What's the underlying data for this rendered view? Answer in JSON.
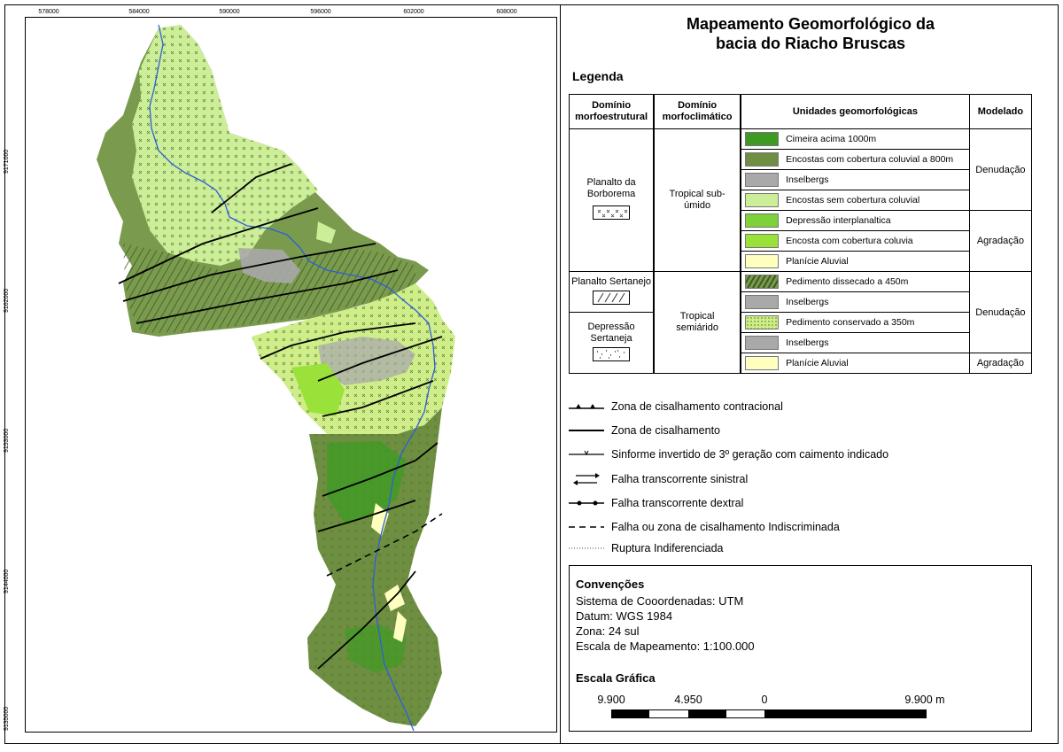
{
  "title_line1": "Mapeamento Geomorfológico da",
  "title_line2": "bacia do Riacho Bruscas",
  "legend_heading": "Legenda",
  "table_headers": {
    "morfoestrutural": "Domínio morfoestrutural",
    "morfoclimatico": "Domínio morfoclimático",
    "unidades": "Unidades geomorfológicas",
    "modelado": "Modelado"
  },
  "domains": {
    "planalto_borborema": "Planalto da Borborema",
    "planalto_sertanejo": "Planalto Sertanejo",
    "depressao_sertaneja": "Depressão Sertaneja",
    "tropical_subumido": "Tropical sub-úmido",
    "tropical_semiarido": "Tropical semiárido"
  },
  "units": [
    {
      "label": "Cimeira acima 1000m",
      "color": "#3f9a24",
      "pattern": "x"
    },
    {
      "label": "Encostas com cobertura coluvial a 800m",
      "color": "#6e8f42",
      "pattern": "x"
    },
    {
      "label": "Inselbergs",
      "color": "#a9a9a9",
      "pattern": "none"
    },
    {
      "label": "Encostas sem cobertura coluvial",
      "color": "#ccee99",
      "pattern": "x"
    },
    {
      "label": "Depressão interplanaltica",
      "color": "#7fd13a",
      "pattern": "x"
    },
    {
      "label": "Encosta com cobertura coluvia",
      "color": "#9ae23a",
      "pattern": "none"
    },
    {
      "label": "Planície Aluvial",
      "color": "#ffffc0",
      "pattern": "none"
    },
    {
      "label": "Pedimento dissecado a 450m",
      "color": "#7a9a4e",
      "pattern": "hatch"
    },
    {
      "label": "Inselbergs",
      "color": "#a9a9a9",
      "pattern": "none"
    },
    {
      "label": "Pedimento conservado a 350m",
      "color": "#cfee8a",
      "pattern": "dot"
    },
    {
      "label": "Inselbergs",
      "color": "#a9a9a9",
      "pattern": "none"
    },
    {
      "label": "Planície Aluvial",
      "color": "#ffffc0",
      "pattern": "none"
    }
  ],
  "modelado": {
    "denudacao": "Denudação",
    "agradacao": "Agradação"
  },
  "line_symbols": [
    {
      "label": "Zona de cisalhamento contracional",
      "icon": "thrust-line-icon"
    },
    {
      "label": "Zona de cisalhamento",
      "icon": "shear-line-icon"
    },
    {
      "label": "Sinforme invertido de 3º geração com caimento indicado",
      "icon": "synform-icon"
    },
    {
      "label": "Falha transcorrente sinistral",
      "icon": "sinistral-fault-icon"
    },
    {
      "label": "Falha transcorrente dextral",
      "icon": "dextral-fault-icon"
    },
    {
      "label": "Falha ou zona de cisalhamento Indiscriminada",
      "icon": "dashed-fault-icon"
    },
    {
      "label": "Ruptura Indiferenciada",
      "icon": "rupture-icon"
    }
  ],
  "conventions": {
    "title": "Convenções",
    "lines": [
      "Sistema de Cooordenadas: UTM",
      "Datum: WGS 1984",
      "Zona: 24 sul",
      "Escala de Mapeamento: 1:100.000"
    ],
    "scale_title": "Escala Gráfica",
    "scale_labels": [
      "9.900",
      "4.950",
      "0",
      "9.900 m"
    ]
  },
  "x_ticks": [
    "578000",
    "584000",
    "590000",
    "596000",
    "602000",
    "608000"
  ],
  "y_ticks": [
    "9171000",
    "9162000",
    "9153000",
    "9144000",
    "9135000"
  ],
  "colors": {
    "river": "#2d5fd8",
    "cimeira": "#3f9a24",
    "encosta_coluvial": "#6e8f42",
    "encostas_sem": "#ccee99",
    "pedimento_dissecado": "#7a9a4e",
    "pedimento_conservado": "#cfee8a",
    "inselberg": "#a9a9a9",
    "planicie": "#ffffc0"
  }
}
